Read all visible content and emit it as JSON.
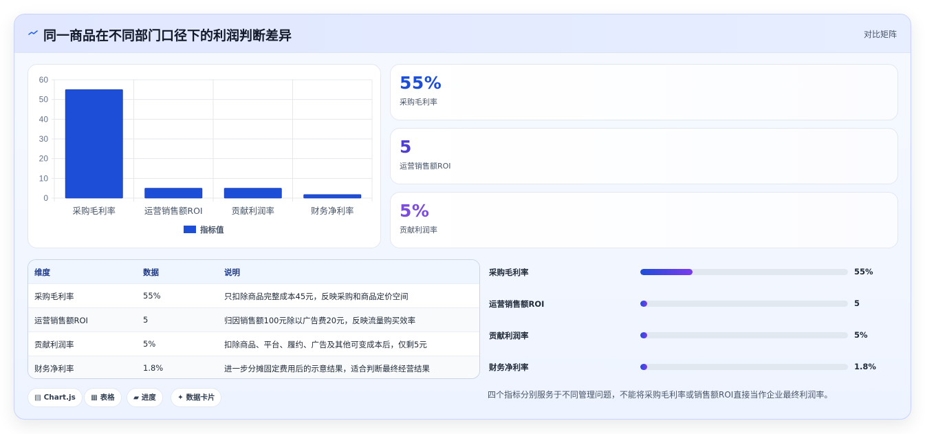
{
  "header": {
    "title": "同一商品在不同部门口径下的利润判断差异",
    "tag": "对比矩阵"
  },
  "colors": {
    "primary": "#1d4ed8",
    "violet": "#5b3fd6",
    "purple": "#7c4ddb",
    "bar": "#1d4ed8"
  },
  "chart_data": {
    "type": "bar",
    "categories": [
      "采购毛利率",
      "运营销售额ROI",
      "贡献利润率",
      "财务净利率"
    ],
    "series": [
      {
        "name": "指标值",
        "values": [
          55,
          5,
          5,
          1.8
        ]
      }
    ],
    "ylim": [
      0,
      60
    ],
    "yticks": [
      0,
      10,
      20,
      30,
      40,
      50,
      60
    ],
    "legend": "bottom",
    "grid": true
  },
  "kpis": [
    {
      "value": "55%",
      "label": "采购毛利率"
    },
    {
      "value": "5",
      "label": "运营销售额ROI"
    },
    {
      "value": "5%",
      "label": "贡献利润率"
    }
  ],
  "table": {
    "headers": [
      "维度",
      "数据",
      "说明"
    ],
    "rows": [
      [
        "采购毛利率",
        "55%",
        "只扣除商品完整成本45元，反映采购和商品定价空间"
      ],
      [
        "运营销售额ROI",
        "5",
        "归因销售额100元除以广告费20元，反映流量购买效率"
      ],
      [
        "贡献利润率",
        "5%",
        "扣除商品、平台、履约、广告及其他可变成本后，仅剩5元"
      ],
      [
        "财务净利率",
        "1.8%",
        "进一步分摊固定费用后的示意结果，适合判断最终经营结果"
      ]
    ]
  },
  "progress": [
    {
      "label": "采购毛利率",
      "value": "55%",
      "fraction": 0.25
    },
    {
      "label": "运营销售额ROI",
      "value": "5",
      "fraction": 0.02
    },
    {
      "label": "贡献利润率",
      "value": "5%",
      "fraction": 0.02
    },
    {
      "label": "财务净利率",
      "value": "1.8%",
      "fraction": 0.02
    }
  ],
  "pills": [
    {
      "icon": "▤",
      "label": "Chart.js"
    },
    {
      "icon": "▦",
      "label": "表格"
    },
    {
      "icon": "▰",
      "label": "进度"
    },
    {
      "icon": "✦",
      "label": "数据卡片"
    }
  ],
  "note": "四个指标分别服务于不同管理问题，不能将采购毛利率或销售额ROI直接当作企业最终利润率。"
}
